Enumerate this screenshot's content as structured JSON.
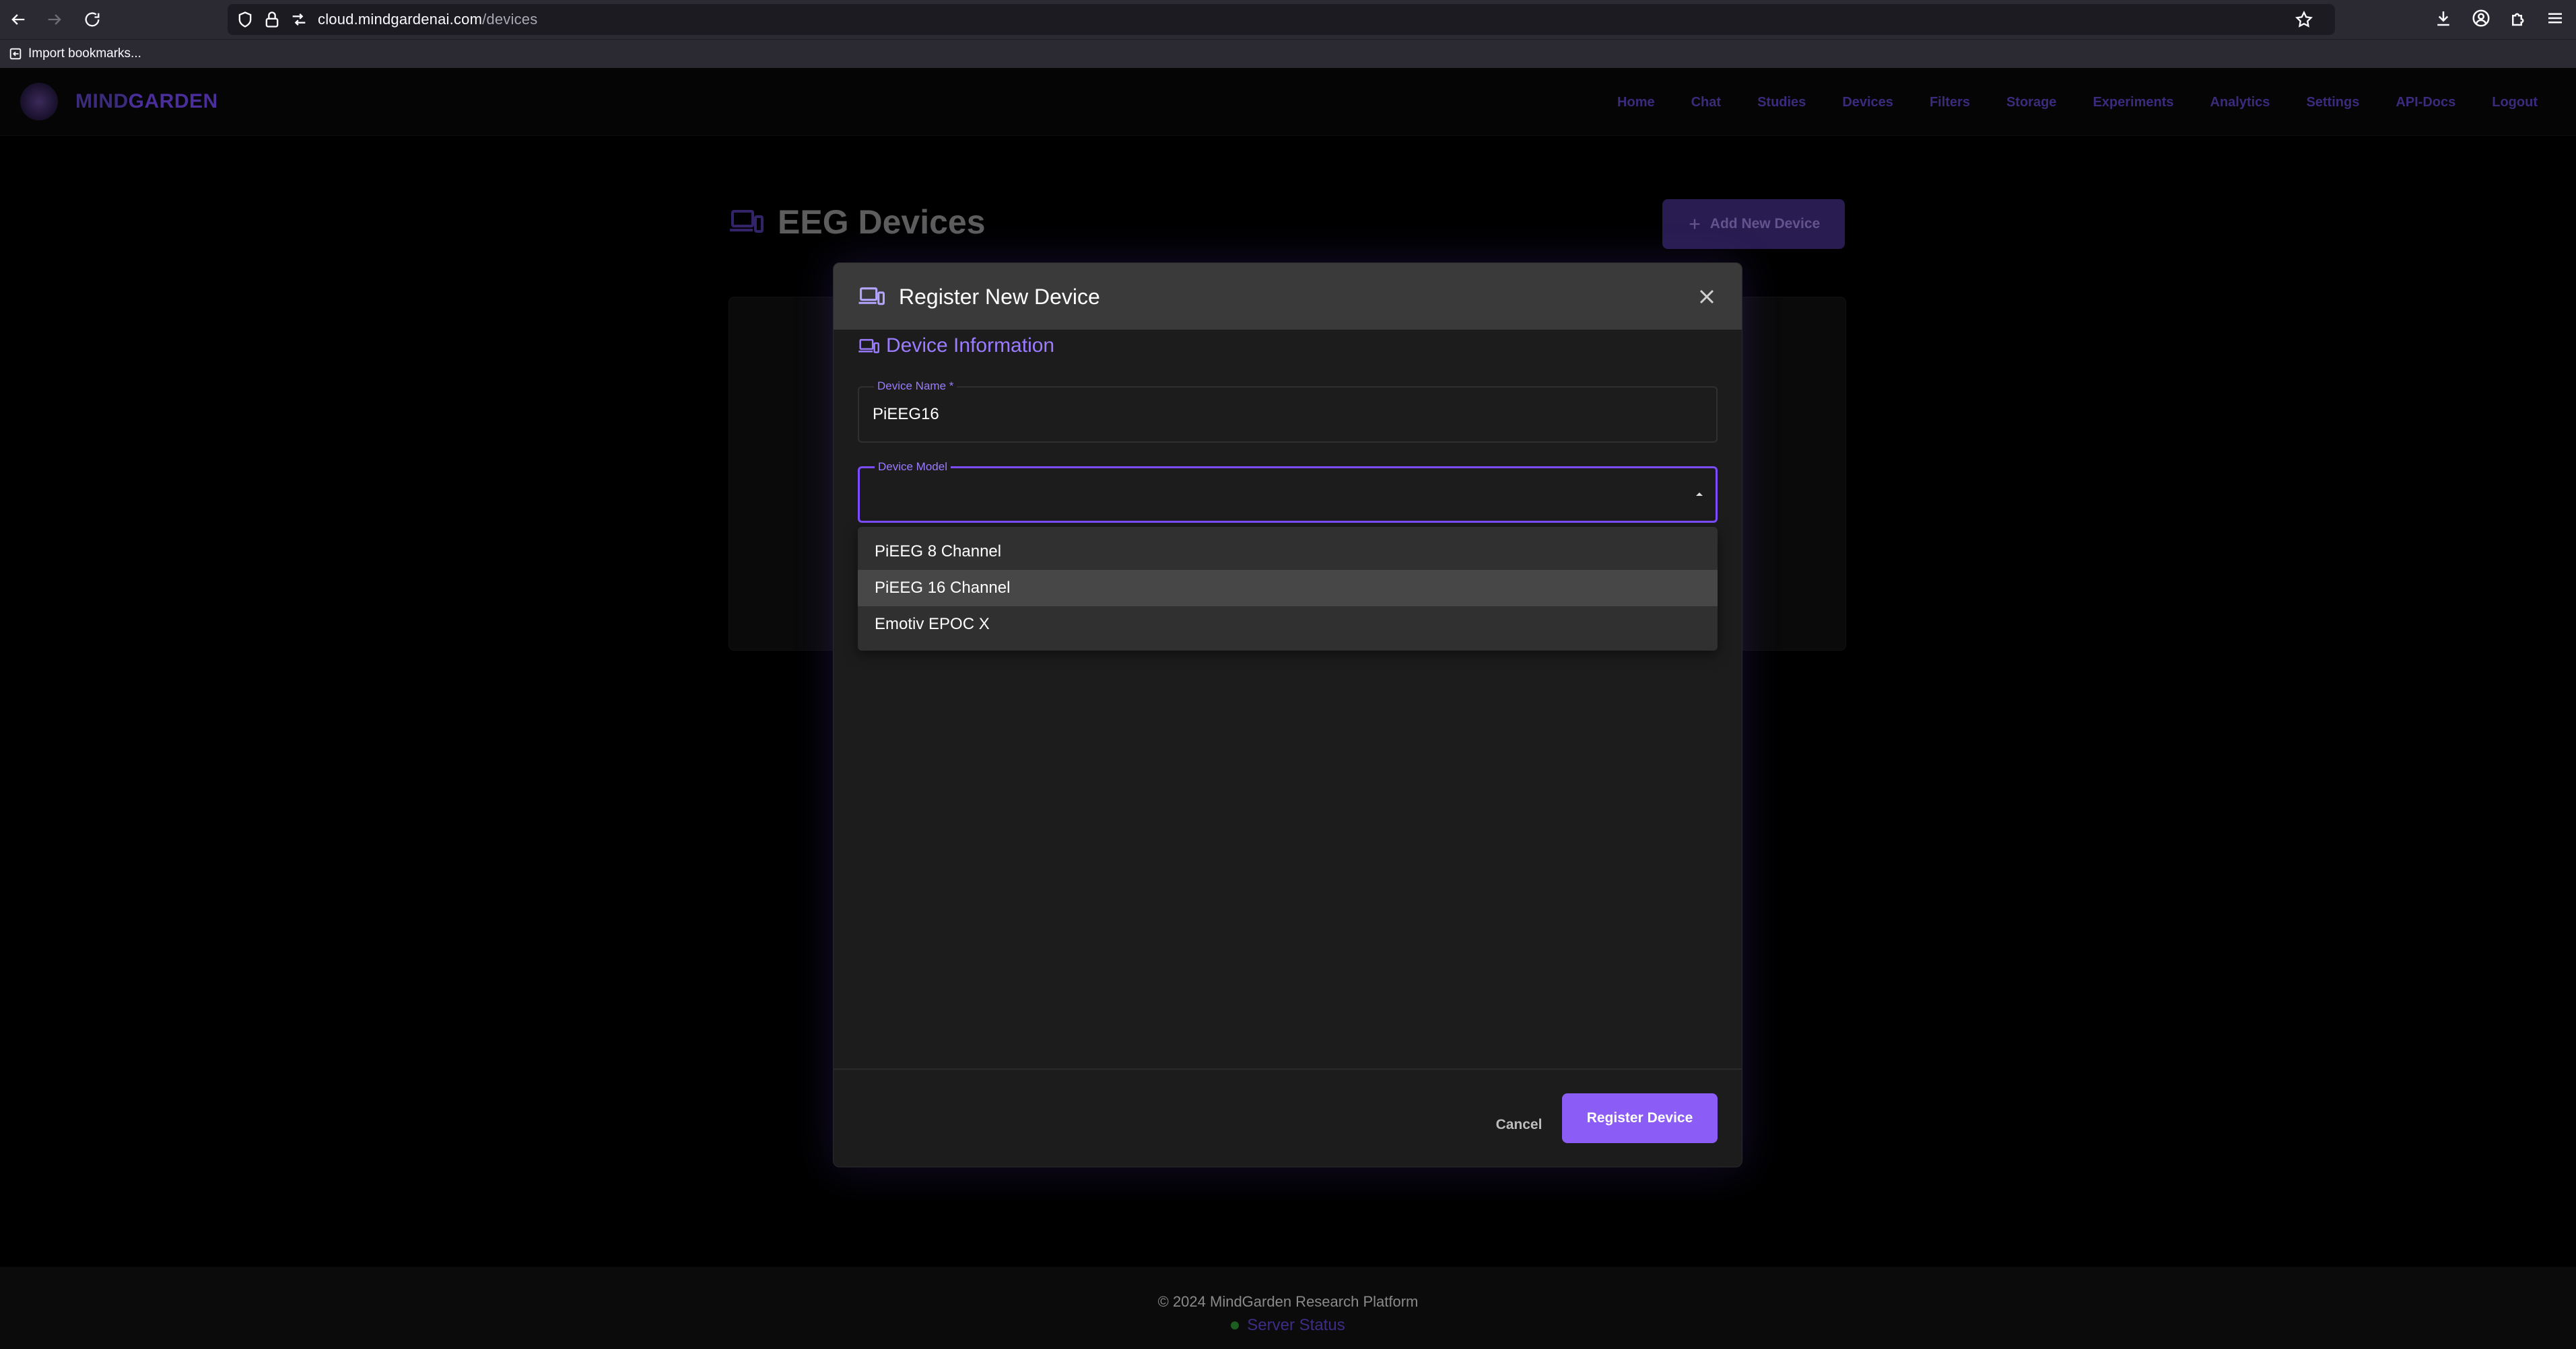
{
  "browser": {
    "url_host": "cloud.mindgardenai.com",
    "url_path": "/devices",
    "bookmarks_label": "Import bookmarks..."
  },
  "app": {
    "brand_part1": "MIND",
    "brand_part2": "GARDEN",
    "nav": [
      "Home",
      "Chat",
      "Studies",
      "Devices",
      "Filters",
      "Storage",
      "Experiments",
      "Analytics",
      "Settings",
      "API-Docs",
      "Logout"
    ]
  },
  "page": {
    "title": "EEG Devices",
    "add_button": "Add New Device"
  },
  "modal": {
    "title": "Register New Device",
    "section_title": "Device Information",
    "device_name": {
      "label": "Device Name *",
      "value": "PiEEG16"
    },
    "device_model": {
      "label": "Device Model",
      "value": ""
    },
    "options": [
      "PiEEG 8 Channel",
      "PiEEG 16 Channel",
      "Emotiv EPOC X"
    ],
    "highlighted_option": "PiEEG 16 Channel",
    "cancel_label": "Cancel",
    "submit_label": "Register Device"
  },
  "footer": {
    "copyright": "© 2024 MindGarden Research Platform",
    "server_status": "Server Status"
  },
  "colors": {
    "accent": "#8c5cf6",
    "focus_border": "#7c4dff",
    "status_ok": "#1b5e20"
  }
}
